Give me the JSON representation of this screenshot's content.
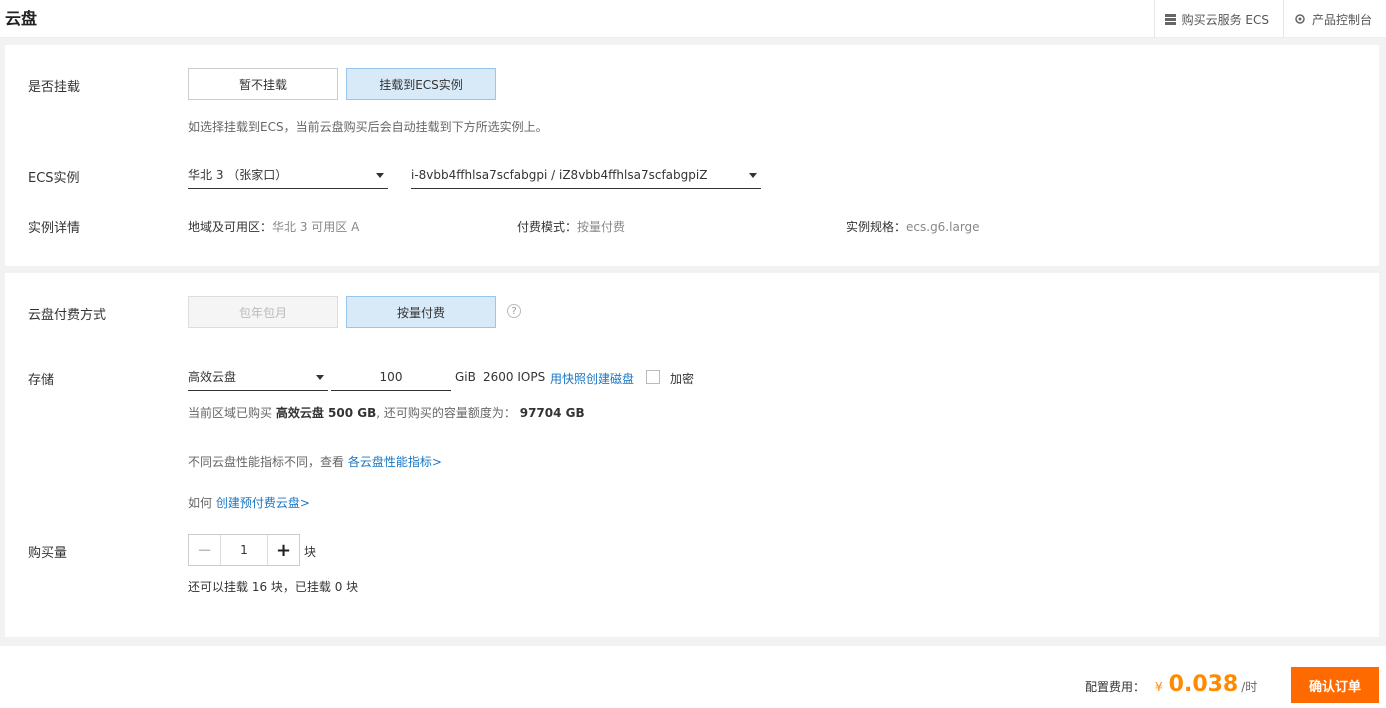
{
  "header": {
    "title": "云盘",
    "links": [
      {
        "label": "购买云服务 ECS",
        "icon": "server-icon"
      },
      {
        "label": "产品控制台",
        "icon": "gear-icon"
      }
    ]
  },
  "mount": {
    "label": "是否挂载",
    "options": [
      "暂不挂载",
      "挂载到ECS实例"
    ],
    "selected": "挂载到ECS实例",
    "hint": "如选择挂载到ECS，当前云盘购买后会自动挂载到下方所选实例上。"
  },
  "ecs": {
    "label": "ECS实例",
    "region": "华北 3 （张家口）",
    "instance": "i-8vbb4ffhlsa7scfabgpi / iZ8vbb4ffhlsa7scfabgpiZ"
  },
  "details": {
    "label": "实例详情",
    "zone_key": "地域及可用区：",
    "zone_value": "华北 3 可用区 A",
    "billing_key": "付费模式：",
    "billing_value": "按量付费",
    "spec_key": "实例规格：",
    "spec_value": "ecs.g6.large"
  },
  "billing": {
    "label": "云盘付费方式",
    "options": [
      "包年包月",
      "按量付费"
    ],
    "selected": "按量付费",
    "help": "?"
  },
  "storage": {
    "label": "存储",
    "disk_type": "高效云盘",
    "size": "100",
    "unit": "GiB",
    "iops": "2600 IOPS",
    "snapshot_link": "用快照创建磁盘",
    "encrypt_label": "加密",
    "quota_prefix": "当前区域已购买",
    "quota_bought": "高效云盘 500 GB",
    "quota_middle": ", 还可购买的容量额度为：",
    "quota_remaining": "97704 GB",
    "perf_text": "不同云盘性能指标不同，查看",
    "perf_link": "各云盘性能指标>",
    "prepaid_text": "如何",
    "prepaid_link": "创建预付费云盘>"
  },
  "quantity": {
    "label": "购买量",
    "value": "1",
    "unit": "块",
    "minus": "−",
    "plus": "+",
    "hint": "还可以挂载 16 块，已挂载 0 块"
  },
  "footer": {
    "cost_label": "配置费用：",
    "currency": "¥",
    "cost_value": "0.038",
    "cost_unit": "/时",
    "confirm_label": "确认订单"
  },
  "colors": {
    "accent": "#ff6a00",
    "price": "#ff8a00",
    "link": "#1976c4",
    "selected_bg": "#d8eaf8"
  }
}
